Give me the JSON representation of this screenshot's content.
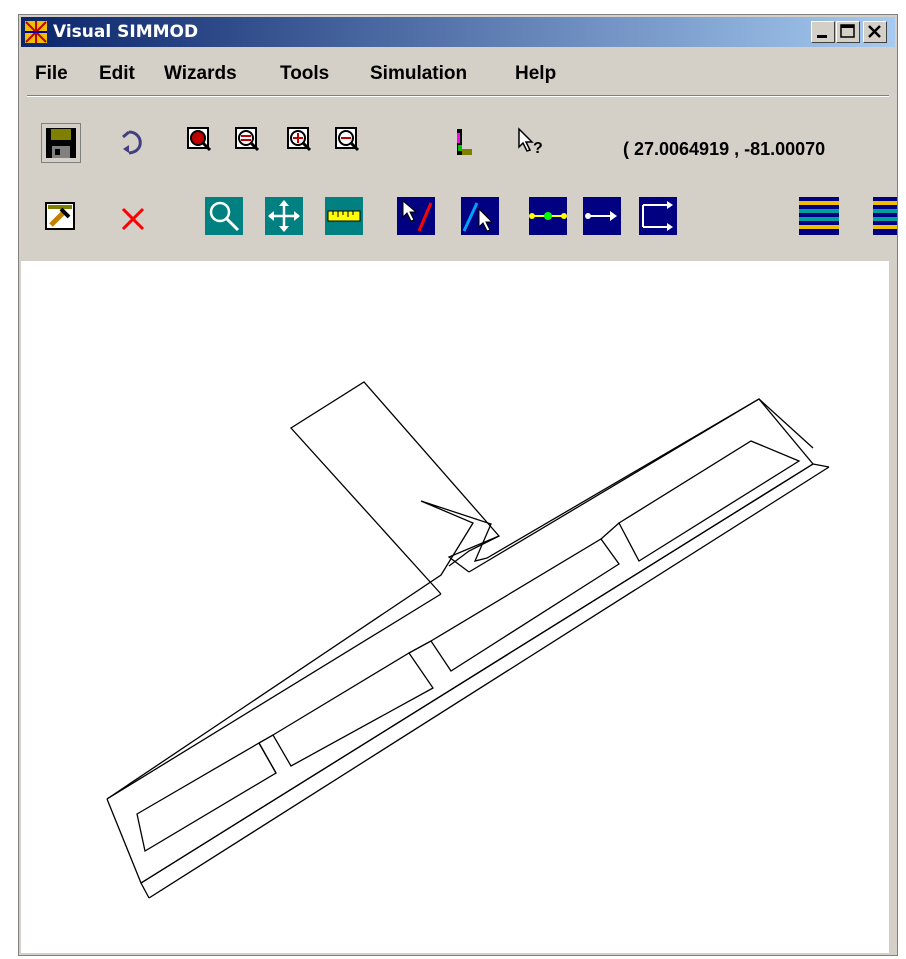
{
  "window": {
    "title": "Visual SIMMOD"
  },
  "menu": [
    {
      "label": "File"
    },
    {
      "label": "Edit"
    },
    {
      "label": "Wizards"
    },
    {
      "label": "Tools"
    },
    {
      "label": "Simulation"
    },
    {
      "label": "Help"
    }
  ],
  "toolbar": {
    "coordinates": "( 27.0064919 , -81.00070"
  },
  "colors": {
    "title_start": "#0a246a",
    "title_end": "#a6caf0",
    "chrome": "#d4d0c8",
    "teal_tool": "#008080",
    "navy_tool": "#000080"
  },
  "icons": [
    "app-icon",
    "minimize-icon",
    "maximize-icon",
    "close-icon",
    "save-icon",
    "undo-icon",
    "zoom-in-icon",
    "zoom-out-icon",
    "zoom-fit-icon",
    "zoom-reset-icon",
    "layers-icon",
    "help-cursor-icon",
    "properties-icon",
    "delete-icon",
    "magnify-icon",
    "pan-icon",
    "ruler-icon",
    "draw-link-icon",
    "select-link-icon",
    "node-link-icon",
    "arrow-link-icon",
    "route-icon",
    "stripes-icon"
  ]
}
